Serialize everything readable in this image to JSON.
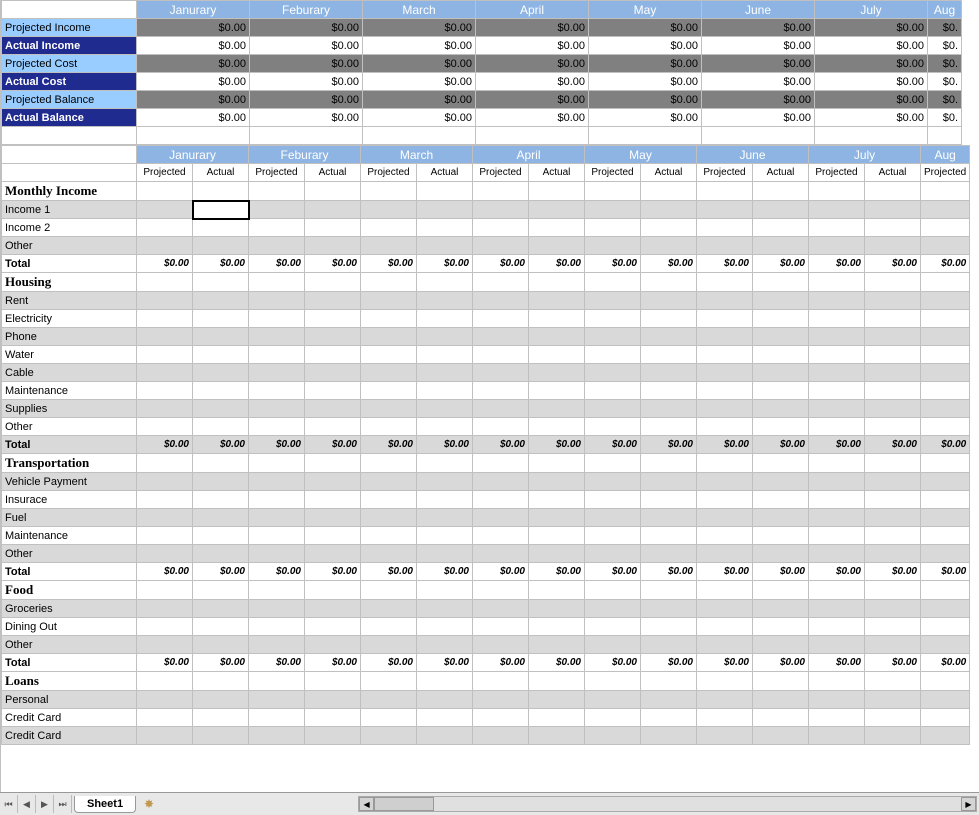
{
  "months": [
    "Janurary",
    "Feburary",
    "March",
    "April",
    "May",
    "June",
    "July",
    "Aug"
  ],
  "partial_last": "Aug",
  "summary_rows": [
    {
      "label": "Projected Income",
      "style": "lightblue",
      "fill": "gray",
      "vals": [
        "$0.00",
        "$0.00",
        "$0.00",
        "$0.00",
        "$0.00",
        "$0.00",
        "$0.00",
        "$0."
      ]
    },
    {
      "label": "Actual Income",
      "style": "darkblue",
      "fill": "white",
      "vals": [
        "$0.00",
        "$0.00",
        "$0.00",
        "$0.00",
        "$0.00",
        "$0.00",
        "$0.00",
        "$0."
      ]
    },
    {
      "label": "Projected Cost",
      "style": "lightblue",
      "fill": "gray",
      "vals": [
        "$0.00",
        "$0.00",
        "$0.00",
        "$0.00",
        "$0.00",
        "$0.00",
        "$0.00",
        "$0."
      ]
    },
    {
      "label": "Actual Cost",
      "style": "darkblue",
      "fill": "white",
      "vals": [
        "$0.00",
        "$0.00",
        "$0.00",
        "$0.00",
        "$0.00",
        "$0.00",
        "$0.00",
        "$0."
      ]
    },
    {
      "label": "Projected Balance",
      "style": "lightblue",
      "fill": "gray",
      "vals": [
        "$0.00",
        "$0.00",
        "$0.00",
        "$0.00",
        "$0.00",
        "$0.00",
        "$0.00",
        "$0."
      ]
    },
    {
      "label": "Actual Balance",
      "style": "darkblue",
      "fill": "white",
      "vals": [
        "$0.00",
        "$0.00",
        "$0.00",
        "$0.00",
        "$0.00",
        "$0.00",
        "$0.00",
        "$0."
      ]
    }
  ],
  "sub_headers": [
    "Projected",
    "Actual"
  ],
  "sections": [
    {
      "title": "Monthly Income",
      "items": [
        "Income 1",
        "Income 2",
        "Other"
      ],
      "total": true
    },
    {
      "title": "Housing",
      "items": [
        "Rent",
        "Electricity",
        "Phone",
        "Water",
        "Cable",
        "Maintenance",
        "Supplies",
        "Other"
      ],
      "total": true
    },
    {
      "title": "Transportation",
      "items": [
        "Vehicle Payment",
        "Insurace",
        "Fuel",
        "Maintenance",
        "Other"
      ],
      "total": true
    },
    {
      "title": "Food",
      "items": [
        "Groceries",
        "Dining Out",
        "Other"
      ],
      "total": true
    },
    {
      "title": "Loans",
      "items": [
        "Personal",
        "Credit Card",
        "Credit Card"
      ],
      "total": false
    }
  ],
  "total_label": "Total",
  "total_val": "$0.00",
  "sheet_tab": "Sheet1"
}
